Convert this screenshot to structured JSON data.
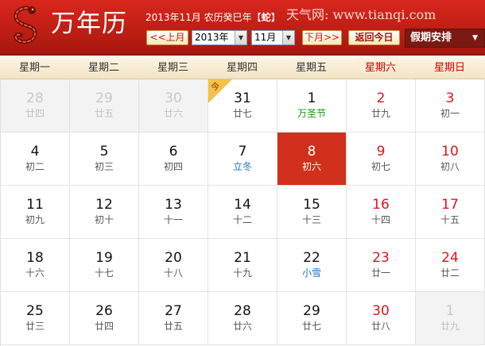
{
  "header": {
    "title": "万年历",
    "info_prefix": "2013年11月 农历癸巳年【",
    "zodiac": "蛇",
    "info_suffix": "】",
    "site": "天气网: www.tianqi.com",
    "prev_label": "<<上月",
    "next_label": "下月>>",
    "today_label": "返回今日",
    "year_value": "2013年",
    "month_value": "11月",
    "holiday_label": "假期安排",
    "colors": {
      "brand": "#c9231a",
      "accent": "#7b1a12"
    }
  },
  "weekdays": [
    "星期一",
    "星期二",
    "星期三",
    "星期四",
    "星期五",
    "星期六",
    "星期日"
  ],
  "today_flag": "今",
  "days": [
    {
      "d": "28",
      "l": "廿四",
      "k": "other"
    },
    {
      "d": "29",
      "l": "廿五",
      "k": "other"
    },
    {
      "d": "30",
      "l": "廿六",
      "k": "other"
    },
    {
      "d": "31",
      "l": "廿七",
      "k": "flagged"
    },
    {
      "d": "1",
      "l": "万圣节",
      "k": "festival"
    },
    {
      "d": "2",
      "l": "廿九",
      "k": "weekend"
    },
    {
      "d": "3",
      "l": "初一",
      "k": "weekend"
    },
    {
      "d": "4",
      "l": "初二",
      "k": ""
    },
    {
      "d": "5",
      "l": "初三",
      "k": ""
    },
    {
      "d": "6",
      "l": "初四",
      "k": ""
    },
    {
      "d": "7",
      "l": "立冬",
      "k": "term"
    },
    {
      "d": "8",
      "l": "初六",
      "k": "today"
    },
    {
      "d": "9",
      "l": "初七",
      "k": "weekend"
    },
    {
      "d": "10",
      "l": "初八",
      "k": "weekend"
    },
    {
      "d": "11",
      "l": "初九",
      "k": ""
    },
    {
      "d": "12",
      "l": "初十",
      "k": ""
    },
    {
      "d": "13",
      "l": "十一",
      "k": ""
    },
    {
      "d": "14",
      "l": "十二",
      "k": ""
    },
    {
      "d": "15",
      "l": "十三",
      "k": ""
    },
    {
      "d": "16",
      "l": "十四",
      "k": "weekend"
    },
    {
      "d": "17",
      "l": "十五",
      "k": "weekend"
    },
    {
      "d": "18",
      "l": "十六",
      "k": ""
    },
    {
      "d": "19",
      "l": "十七",
      "k": ""
    },
    {
      "d": "20",
      "l": "十八",
      "k": ""
    },
    {
      "d": "21",
      "l": "十九",
      "k": ""
    },
    {
      "d": "22",
      "l": "小雪",
      "k": "term"
    },
    {
      "d": "23",
      "l": "廿一",
      "k": "weekend"
    },
    {
      "d": "24",
      "l": "廿二",
      "k": "weekend"
    },
    {
      "d": "25",
      "l": "廿三",
      "k": ""
    },
    {
      "d": "26",
      "l": "廿四",
      "k": ""
    },
    {
      "d": "27",
      "l": "廿五",
      "k": ""
    },
    {
      "d": "28",
      "l": "廿六",
      "k": ""
    },
    {
      "d": "29",
      "l": "廿七",
      "k": ""
    },
    {
      "d": "30",
      "l": "廿八",
      "k": "weekend"
    },
    {
      "d": "1",
      "l": "廿九",
      "k": "other-festival"
    }
  ]
}
